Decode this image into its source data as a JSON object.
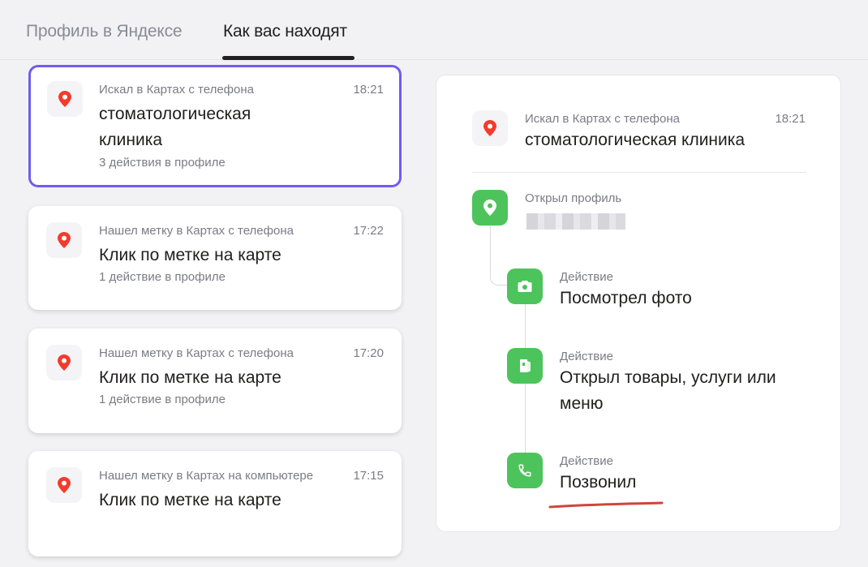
{
  "tabs": [
    {
      "label": "Профиль в Яндексе",
      "active": false
    },
    {
      "label": "Как вас находят",
      "active": true
    }
  ],
  "cards": [
    {
      "subtitle": "Искал в Картах с телефона",
      "time": "18:21",
      "title": "стоматологическая клиника",
      "count": "3 действия в профиле",
      "selected": true
    },
    {
      "subtitle": "Нашел метку в Картах с телефона",
      "time": "17:22",
      "title": "Клик по метке на карте",
      "count": "1 действие в профиле",
      "selected": false
    },
    {
      "subtitle": "Нашел метку в Картах с телефона",
      "time": "17:20",
      "title": "Клик по метке на карте",
      "count": "1 действие в профиле",
      "selected": false
    },
    {
      "subtitle": "Нашел метку в Картах на компьютере",
      "time": "17:15",
      "title": "Клик по метке на карте",
      "count": "",
      "selected": false
    }
  ],
  "detail": {
    "subtitle": "Искал в Картах с телефона",
    "time": "18:21",
    "title": "стоматологическая клиника",
    "profile_label": "Открыл профиль",
    "actions": [
      {
        "label": "Действие",
        "text": "Посмотрел фото",
        "icon": "camera-icon"
      },
      {
        "label": "Действие",
        "text": "Открыл товары, услуги или меню",
        "icon": "menu-book-icon"
      },
      {
        "label": "Действие",
        "text": "Позвонил",
        "icon": "phone-icon"
      }
    ]
  },
  "colors": {
    "accent_border": "#6f5cf0",
    "action_green": "#4dc45b",
    "pin_red": "#f33b2c",
    "annotation_red": "#d0453a"
  },
  "icons": {
    "list_pin": "map-pin-icon",
    "profile": "location-pin-icon"
  }
}
